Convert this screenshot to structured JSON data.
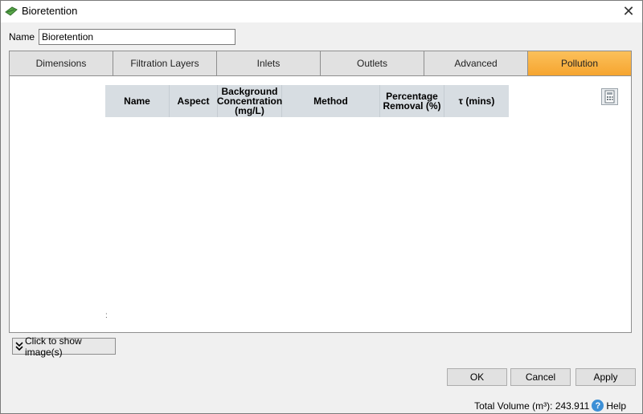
{
  "window": {
    "title": "Bioretention",
    "close_glyph": "✕",
    "app_icon": "bioretention-leaf-icon"
  },
  "name_field": {
    "label": "Name",
    "value": "Bioretention"
  },
  "tabs": [
    {
      "label": "Dimensions",
      "active": false
    },
    {
      "label": "Filtration Layers",
      "active": false
    },
    {
      "label": "Inlets",
      "active": false
    },
    {
      "label": "Outlets",
      "active": false
    },
    {
      "label": "Advanced",
      "active": false
    },
    {
      "label": "Pollution",
      "active": true
    }
  ],
  "grid": {
    "columns": [
      {
        "key": "name",
        "label": "Name"
      },
      {
        "key": "aspect",
        "label": "Aspect"
      },
      {
        "key": "background",
        "label": "Background Concentration (mg/L)"
      },
      {
        "key": "method",
        "label": "Method"
      },
      {
        "key": "removal",
        "label": "Percentage Removal (%)"
      },
      {
        "key": "tau",
        "label": "τ (mins)"
      }
    ],
    "row_marker": ":",
    "calculator_icon": "calculator-icon"
  },
  "show_images_button": {
    "label": "Click to show image(s)",
    "icon": "double-chevron-down-icon"
  },
  "buttons": {
    "ok": "OK",
    "cancel": "Cancel",
    "apply": "Apply"
  },
  "status": {
    "total_volume_text": "Total Volume (m³): 243.911",
    "help_label": "Help",
    "help_icon": "help-icon"
  },
  "colors": {
    "active_tab": "#f6a530",
    "grid_header": "#d7dde2",
    "help_blue": "#3c8fd6"
  }
}
